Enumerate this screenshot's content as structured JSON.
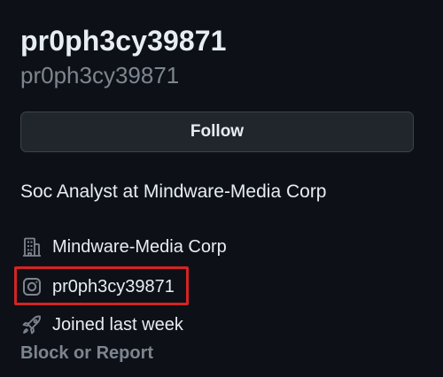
{
  "profile": {
    "display_name": "pr0ph3cy39871",
    "username": "pr0ph3cy39871",
    "follow_label": "Follow",
    "bio": "Soc Analyst at Mindware-Media Corp",
    "organization": "Mindware-Media Corp",
    "social_handle": "pr0ph3cy39871",
    "joined": "Joined last week",
    "block_report_label": "Block or Report"
  },
  "icons": {
    "organization": "building-icon",
    "social": "instagram-icon",
    "joined": "rocket-icon"
  },
  "colors": {
    "background": "#0d1117",
    "text": "#e6edf3",
    "muted": "#7d8590",
    "button_bg": "#21262d",
    "highlight": "#d42424"
  }
}
